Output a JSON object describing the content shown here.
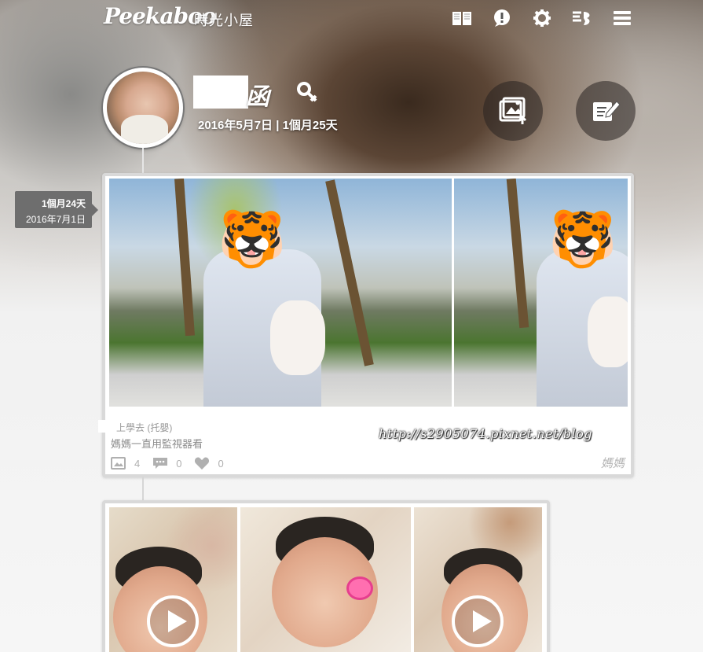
{
  "app": {
    "logo": "Peekaboo",
    "subtitle": "時光小屋"
  },
  "nav": {
    "icons": [
      "book-icon",
      "notice-icon",
      "gear-icon",
      "switch-profile-icon",
      "menu-icon"
    ]
  },
  "profile": {
    "name": "函",
    "birth_info": "2016年5月7日 | 1個月25天",
    "actions": [
      "upload-photo-icon",
      "write-post-icon"
    ]
  },
  "timeline": {
    "age": "1個月24天",
    "date": "2016年7月1日"
  },
  "post1": {
    "caption_line1": "上學去 (托嬰)",
    "caption_line2": "媽媽一直用監視器看",
    "watermark": "http://s2905074.pixnet.net/blog",
    "photo_count": "4",
    "comment_count": "0",
    "like_count": "0",
    "author": "媽媽"
  },
  "colors": {
    "card_border": "#d9d9d9",
    "tag_bg": "#6e6e6e",
    "stat_text": "#b0b0b0"
  }
}
